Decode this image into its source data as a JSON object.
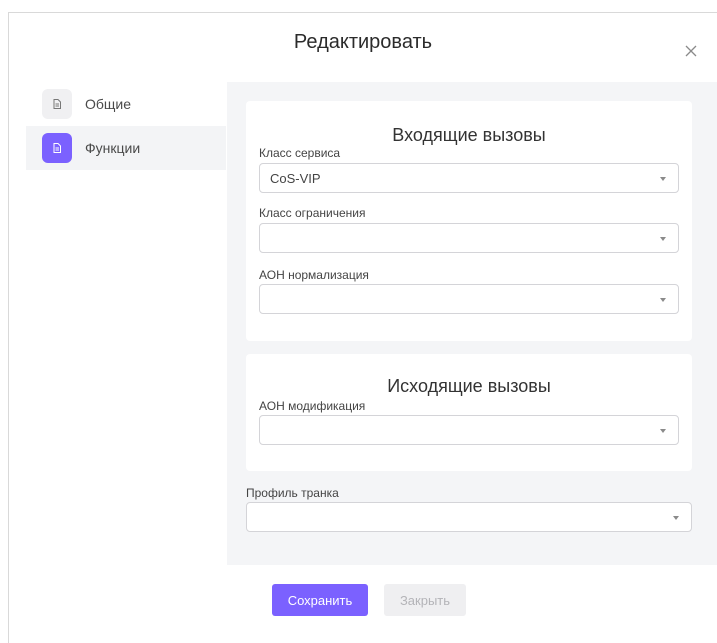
{
  "dialog": {
    "title": "Редактировать",
    "close_icon": "close-icon"
  },
  "sidebar": {
    "items": [
      {
        "label": "Общие",
        "icon": "document-icon",
        "active": false
      },
      {
        "label": "Функции",
        "icon": "document-icon",
        "active": true
      }
    ]
  },
  "incoming": {
    "title": "Входящие вызовы",
    "service_class": {
      "label": "Класс сервиса",
      "value": "CoS-VIP"
    },
    "restriction_class": {
      "label": "Класс ограничения",
      "value": ""
    },
    "cli_normalization": {
      "label": "АОН нормализация",
      "value": ""
    }
  },
  "outgoing": {
    "title": "Исходящие вызовы",
    "cli_modification": {
      "label": "АОН модификация",
      "value": ""
    }
  },
  "trunk_profile": {
    "label": "Профиль транка",
    "value": ""
  },
  "buttons": {
    "save": "Сохранить",
    "close": "Закрыть"
  },
  "colors": {
    "accent": "#7b61ff",
    "panel_bg": "#f4f5f7",
    "disabled_btn_bg": "#efeff1",
    "disabled_btn_text": "#b4b4b8"
  }
}
